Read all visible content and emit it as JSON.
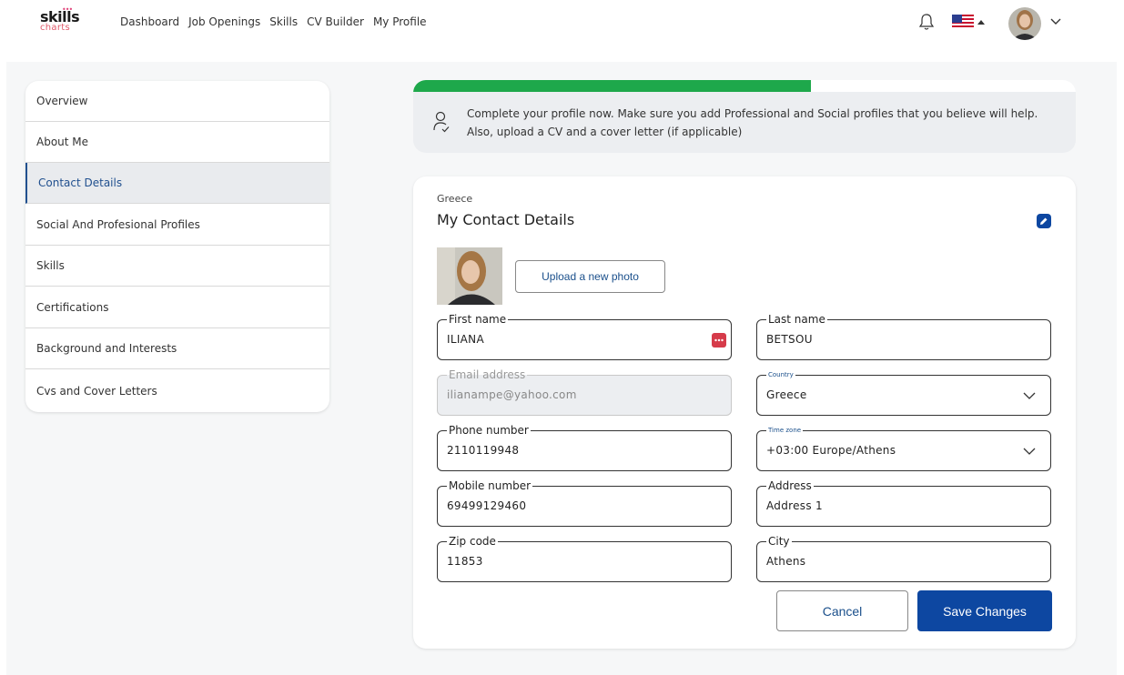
{
  "logo": {
    "line1": "skills",
    "line2": "charts"
  },
  "nav": {
    "items": [
      {
        "label": "Dashboard"
      },
      {
        "label": "Job Openings"
      },
      {
        "label": "Skills"
      },
      {
        "label": "CV Builder"
      },
      {
        "label": "My Profile"
      }
    ],
    "icons": {
      "bell": "bell-icon",
      "flag": "us-flag-icon",
      "avatar": "user-avatar",
      "chevron": "chevron-down-icon"
    }
  },
  "sidebar": {
    "items": [
      {
        "label": "Overview"
      },
      {
        "label": "About Me"
      },
      {
        "label": "Contact Details",
        "active": true
      },
      {
        "label": "Social And Profesional Profiles"
      },
      {
        "label": "Skills"
      },
      {
        "label": "Certifications"
      },
      {
        "label": "Background and Interests"
      },
      {
        "label": "Cvs and Cover Letters"
      }
    ]
  },
  "progress": {
    "fraction": 0.6,
    "message": "Complete your profile now. Make sure you add Professional and Social profiles that you believe will help. Also, upload a CV and a cover letter (if applicable)",
    "color": "#1ea84b"
  },
  "card": {
    "country": "Greece",
    "title": "My Contact Details",
    "upload_label": "Upload a new photo"
  },
  "fields": {
    "first_name": {
      "label": "First name",
      "value": "ILIANA"
    },
    "last_name": {
      "label": "Last name",
      "value": "BETSOU"
    },
    "email": {
      "label": "Email address",
      "value": "ilianampe@yahoo.com",
      "disabled": true
    },
    "country": {
      "label": "Country",
      "value": "Greece"
    },
    "phone": {
      "label": "Phone number",
      "value": "2110119948"
    },
    "timezone": {
      "label": "Time zone",
      "value": "+03:00 Europe/Athens"
    },
    "mobile": {
      "label": "Mobile number",
      "value": "69499129460"
    },
    "address": {
      "label": "Address",
      "value": "Address 1"
    },
    "zip": {
      "label": "Zip code",
      "value": "11853"
    },
    "city": {
      "label": "City",
      "value": "Athens"
    }
  },
  "actions": {
    "cancel": "Cancel",
    "save": "Save Changes"
  },
  "colors": {
    "primary": "#0d47a1",
    "accent_red": "#d63b4a",
    "active_text": "#21508f"
  }
}
